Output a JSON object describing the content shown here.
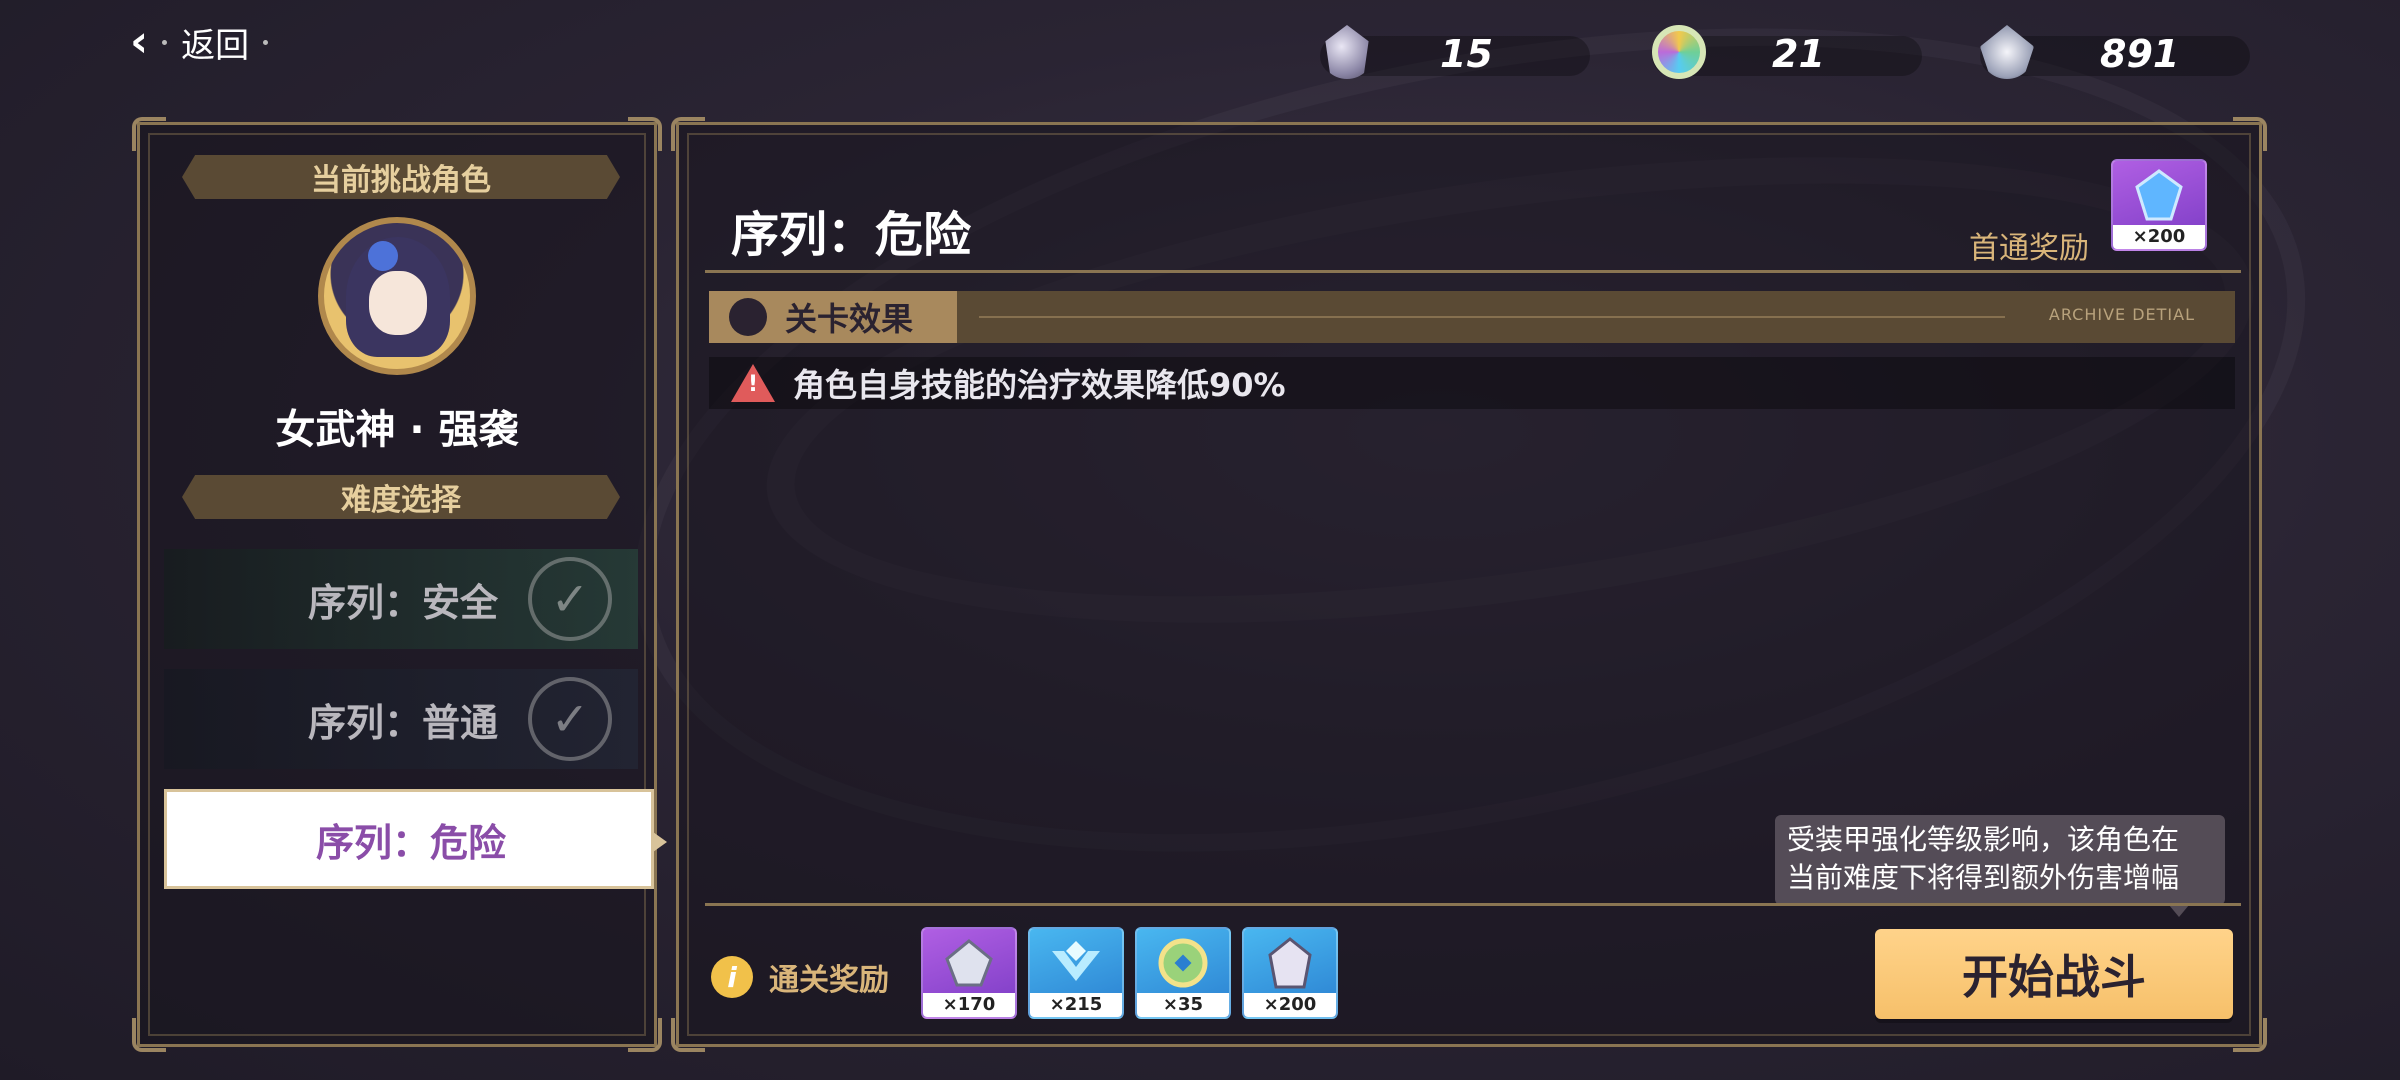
{
  "header": {
    "back_label": "返回",
    "resources": [
      {
        "icon": "crystal-shard-icon",
        "value": "15"
      },
      {
        "icon": "rainbow-coin-icon",
        "value": "21"
      },
      {
        "icon": "feather-badge-icon",
        "value": "891"
      }
    ]
  },
  "left_panel": {
    "current_challenge_title": "当前挑战角色",
    "character_name": "女武神 · 强袭",
    "difficulty_title": "难度选择",
    "difficulties": [
      {
        "label": "序列：安全",
        "completed": true
      },
      {
        "label": "序列：普通",
        "completed": true
      },
      {
        "label": "序列：危险",
        "selected": true
      }
    ]
  },
  "main_panel": {
    "stage_title": "序列：危险",
    "first_clear_label": "首通奖励",
    "first_clear_reward": {
      "icon": "blue-crystal-icon",
      "count": "×200"
    },
    "effect_section_label": "关卡效果",
    "effect_section_en": "ARCHIVE DETIAL",
    "effects": [
      "角色自身技能的治疗效果降低90%"
    ],
    "tooltip_lines": [
      "受装甲强化等级影响，该角色在",
      "当前难度下将得到额外伤害增幅"
    ],
    "clear_reward_label": "通关奖励",
    "clear_rewards": [
      {
        "icon": "feather-badge-icon",
        "count": "×170"
      },
      {
        "icon": "blue-chevron-icon",
        "count": "×215"
      },
      {
        "icon": "rainbow-coin-icon",
        "count": "×35"
      },
      {
        "icon": "crystal-shard-icon",
        "count": "×200"
      }
    ],
    "start_button_label": "开始战斗"
  },
  "colors": {
    "accent_gold": "#f6c06a",
    "frame_gold": "#8a7552",
    "selected_text": "#8a4da8",
    "warning_red": "#e05b5b"
  }
}
